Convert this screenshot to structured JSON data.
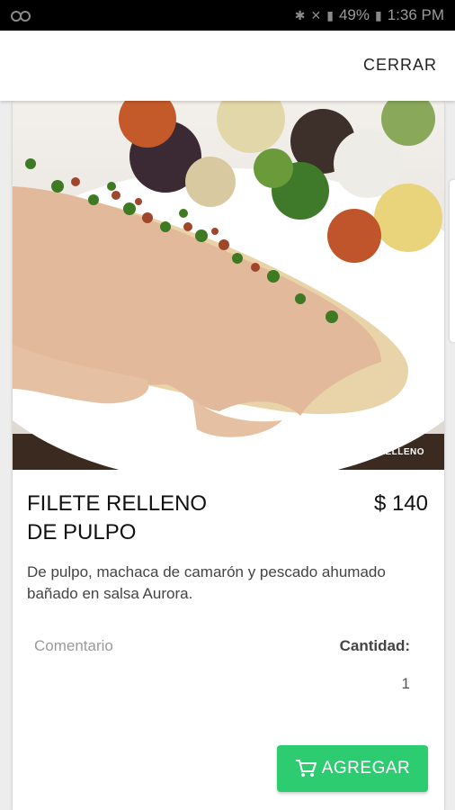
{
  "status_bar": {
    "icons": [
      "voicemail-icon",
      "bluetooth-icon",
      "mute-icon",
      "signal-icon",
      "battery-icon"
    ],
    "battery": "49%",
    "time": "1:36 PM"
  },
  "header": {
    "close_label": "CERRAR"
  },
  "product": {
    "image_caption": "FILETE RELLENO",
    "title_line1": "FILETE RELLENO",
    "title_line2": "DE PULPO",
    "price": "$ 140",
    "description": "De pulpo, machaca de camarón y pescado ahumado bañado en salsa Aurora."
  },
  "order": {
    "comment_placeholder": "Comentario",
    "comment_value": "",
    "quantity_label": "Cantidad:",
    "quantity_value": "1",
    "add_label": "AGREGAR"
  },
  "colors": {
    "accent": "#2ecc71",
    "status_bar": "#000000"
  }
}
